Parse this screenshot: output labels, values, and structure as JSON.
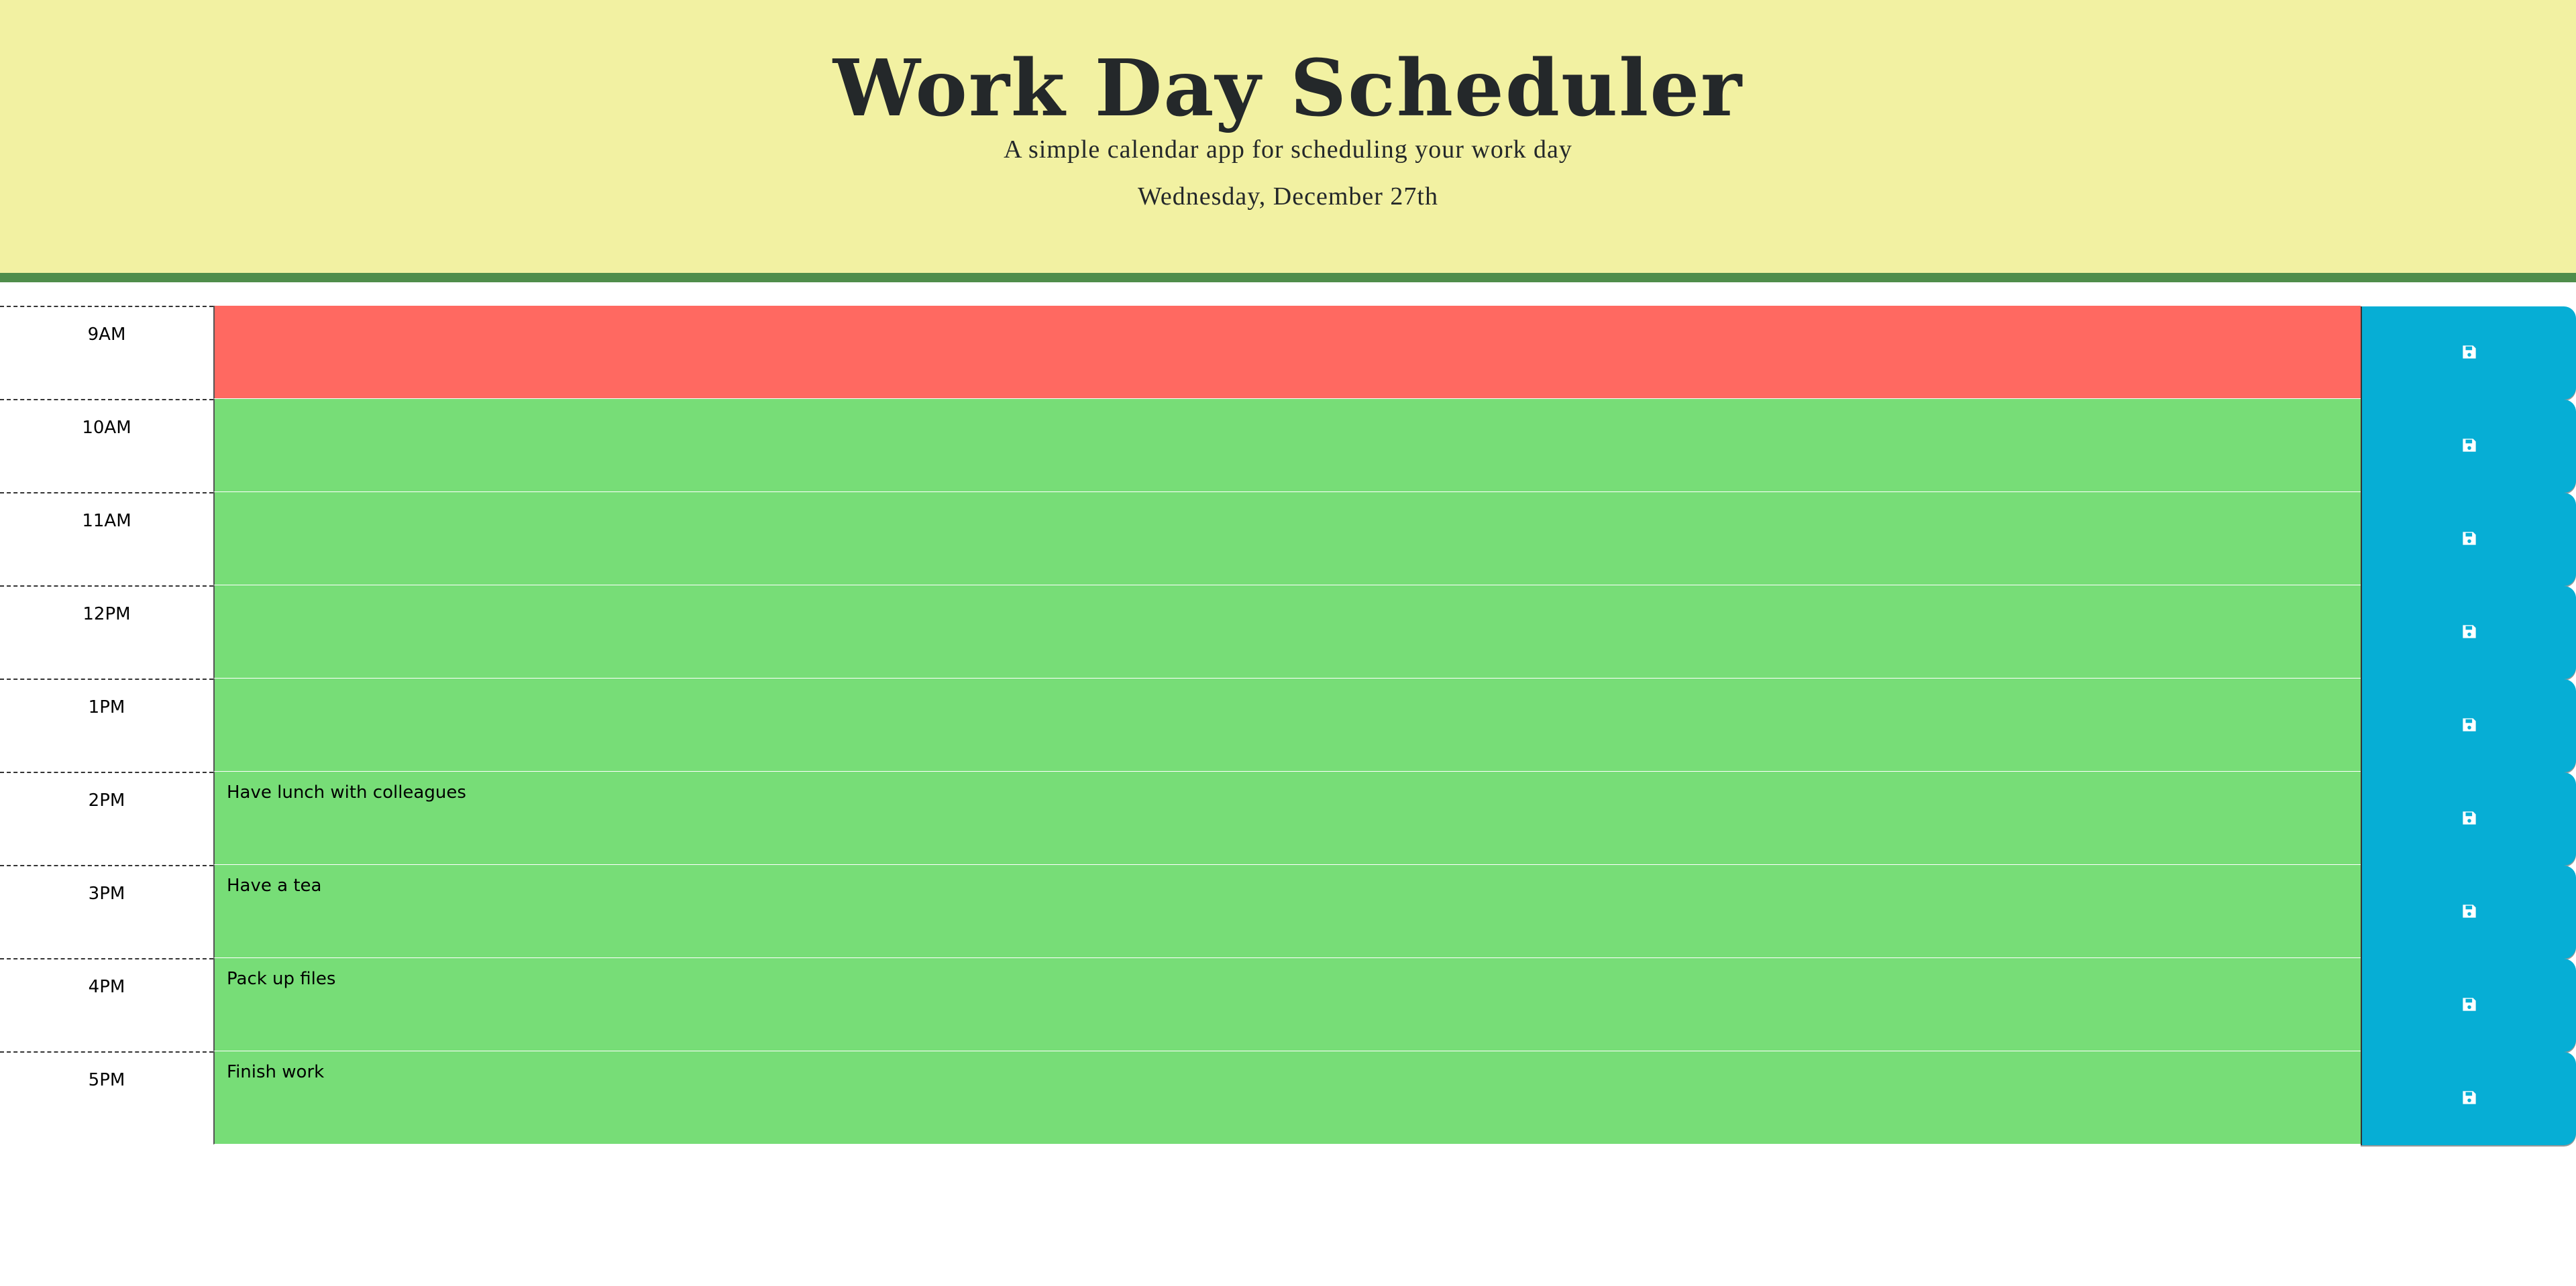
{
  "header": {
    "title": "Work Day Scheduler",
    "subtitle": "A simple calendar app for scheduling your work day",
    "current_day": "Wednesday, December 27th"
  },
  "colors": {
    "header_bg": "#f2f1a2",
    "header_border": "#4f8d4b",
    "present": "#ff6961",
    "future": "#77dd77",
    "save_button": "#06aed5"
  },
  "rows": [
    {
      "hour": "9AM",
      "text": "",
      "status": "present",
      "save_icon": "save-icon"
    },
    {
      "hour": "10AM",
      "text": "",
      "status": "future",
      "save_icon": "save-icon"
    },
    {
      "hour": "11AM",
      "text": "",
      "status": "future",
      "save_icon": "save-icon"
    },
    {
      "hour": "12PM",
      "text": "",
      "status": "future",
      "save_icon": "save-icon"
    },
    {
      "hour": "1PM",
      "text": "",
      "status": "future",
      "save_icon": "save-icon"
    },
    {
      "hour": "2PM",
      "text": "Have lunch with colleagues",
      "status": "future",
      "save_icon": "save-icon"
    },
    {
      "hour": "3PM",
      "text": "Have a tea",
      "status": "future",
      "save_icon": "save-icon"
    },
    {
      "hour": "4PM",
      "text": "Pack up files",
      "status": "future",
      "save_icon": "save-icon"
    },
    {
      "hour": "5PM",
      "text": "Finish work",
      "status": "future",
      "save_icon": "save-icon"
    }
  ]
}
